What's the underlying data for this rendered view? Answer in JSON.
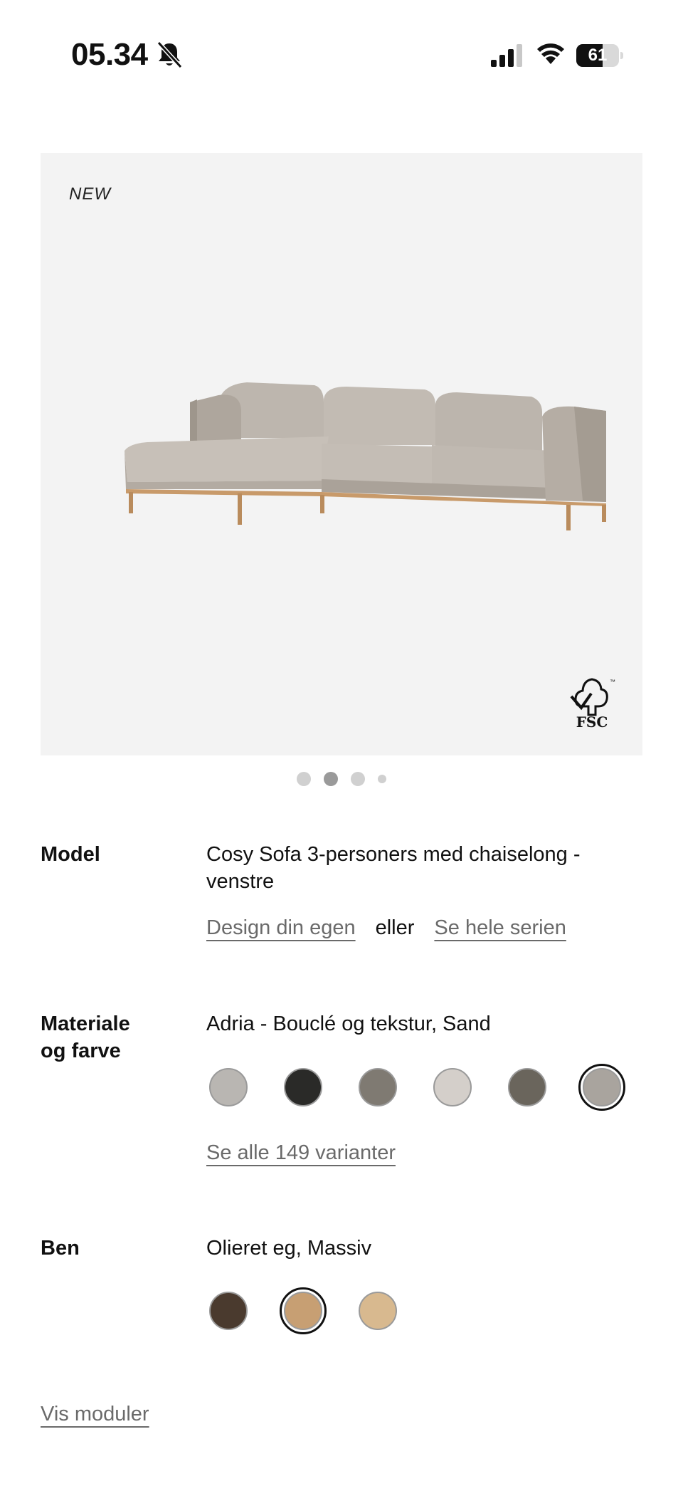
{
  "status_bar": {
    "time": "05.34",
    "battery": "61",
    "battery_level": 0.61,
    "icons": [
      "bell-slash-icon",
      "cellular-signal-icon",
      "wifi-icon",
      "battery-icon"
    ]
  },
  "hero": {
    "badge": "NEW",
    "logo_text": "FSC",
    "carousel": {
      "count": 4,
      "active_index": 1
    }
  },
  "model": {
    "label": "Model",
    "value_line1": "Cosy Sofa 3-personers med chaiselong -",
    "value_line2": "venstre",
    "design_link": "Design din egen",
    "or_text": "eller",
    "series_link": "Se hele serien"
  },
  "material": {
    "label_line1": "Materiale",
    "label_line2": "og farve",
    "value": "Adria - Bouclé og tekstur, Sand",
    "swatch_colors": [
      "#b9b6b2",
      "#2a2a28",
      "#7f7a72",
      "#d4cfca",
      "#6a655c",
      "#a9a49e"
    ],
    "selected_index": 5,
    "all_variants_link": "Se alle 149 varianter"
  },
  "legs": {
    "label": "Ben",
    "value": "Olieret eg, Massiv",
    "swatch_colors": [
      "#4a3a2e",
      "#c79f73",
      "#d8b98f"
    ],
    "selected_index": 1
  },
  "footer": {
    "modules_link": "Vis moduler"
  }
}
